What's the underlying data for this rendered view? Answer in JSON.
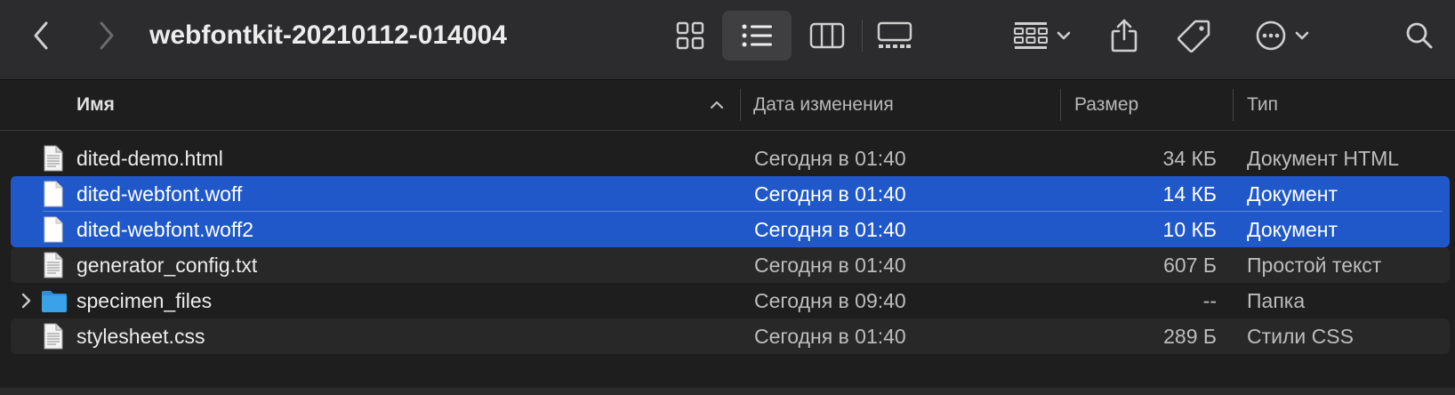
{
  "window": {
    "title": "webfontkit-20210112-014004"
  },
  "toolbar": {
    "back_icon": "chevron-left-icon",
    "forward_icon": "chevron-right-icon",
    "views": [
      "icon-view-icon",
      "list-view-icon",
      "column-view-icon",
      "gallery-view-icon"
    ],
    "active_view": "list",
    "group_icon": "group-by-icon",
    "share_icon": "share-icon",
    "tag_icon": "tag-icon",
    "more_icon": "more-actions-icon",
    "search_icon": "search-icon"
  },
  "columns": {
    "name": "Имя",
    "date": "Дата изменения",
    "size": "Размер",
    "kind": "Тип"
  },
  "files": [
    {
      "name": "dited-demo.html",
      "date": "Сегодня в 01:40",
      "size": "34 КБ",
      "kind": "Документ HTML",
      "icon": "document-icon",
      "selected": false
    },
    {
      "name": "dited-webfont.woff",
      "date": "Сегодня в 01:40",
      "size": "14 КБ",
      "kind": "Документ",
      "icon": "document-icon",
      "selected": true
    },
    {
      "name": "dited-webfont.woff2",
      "date": "Сегодня в 01:40",
      "size": "10 КБ",
      "kind": "Документ",
      "icon": "document-icon",
      "selected": true
    },
    {
      "name": "generator_config.txt",
      "date": "Сегодня в 01:40",
      "size": "607 Б",
      "kind": "Простой текст",
      "icon": "text-document-icon",
      "selected": false
    },
    {
      "name": "specimen_files",
      "date": "Сегодня в 09:40",
      "size": "--",
      "kind": "Папка",
      "icon": "folder-icon",
      "selected": false
    },
    {
      "name": "stylesheet.css",
      "date": "Сегодня в 01:40",
      "size": "289 Б",
      "kind": "Стили CSS",
      "icon": "text-document-icon",
      "selected": false
    }
  ],
  "colors": {
    "selection": "#2058c9",
    "folder": "#3aa3e8",
    "background": "#1e1e1e",
    "toolbar": "#2c2c2e"
  }
}
